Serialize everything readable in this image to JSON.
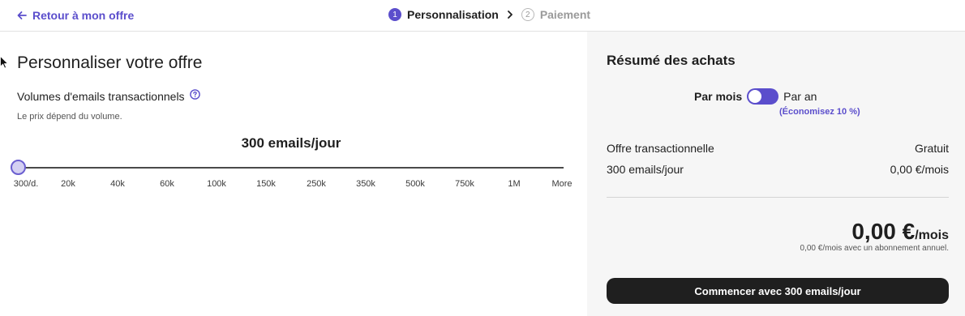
{
  "header": {
    "back_label": "Retour à mon offre",
    "steps": [
      {
        "number": "1",
        "label": "Personnalisation",
        "state": "active"
      },
      {
        "number": "2",
        "label": "Paiement",
        "state": "inactive"
      }
    ]
  },
  "customize": {
    "title": "Personnaliser votre offre",
    "volume_label": "Volumes d'emails transactionnels",
    "volume_hint": "Le prix dépend du volume.",
    "selected_volume": "300 emails/jour",
    "slider_position_index": 0,
    "slider_ticks": [
      "300/d.",
      "20k",
      "40k",
      "60k",
      "100k",
      "150k",
      "250k",
      "350k",
      "500k",
      "750k",
      "1M",
      "More"
    ]
  },
  "summary": {
    "title": "Résumé des achats",
    "billing_monthly": "Par mois",
    "billing_yearly": "Par an",
    "savings": "(Économisez 10 %)",
    "lines": [
      {
        "label": "Offre transactionnelle",
        "value": "Gratuit"
      },
      {
        "label": "300 emails/jour",
        "value": "0,00 €/mois"
      }
    ],
    "total_amount": "0,00 €",
    "total_unit": "/mois",
    "total_note": "0,00 €/mois avec un abonnement annuel.",
    "cta_label": "Commencer avec 300 emails/jour"
  },
  "colors": {
    "accent": "#5b4ecc",
    "cta_background": "#1f1f1f",
    "summary_background": "#f6f6f6"
  },
  "icons": {
    "back": "arrow-left-icon",
    "step_separator": "chevron-right-icon",
    "help": "question-circle-icon",
    "pointer": "mouse-cursor-icon"
  }
}
